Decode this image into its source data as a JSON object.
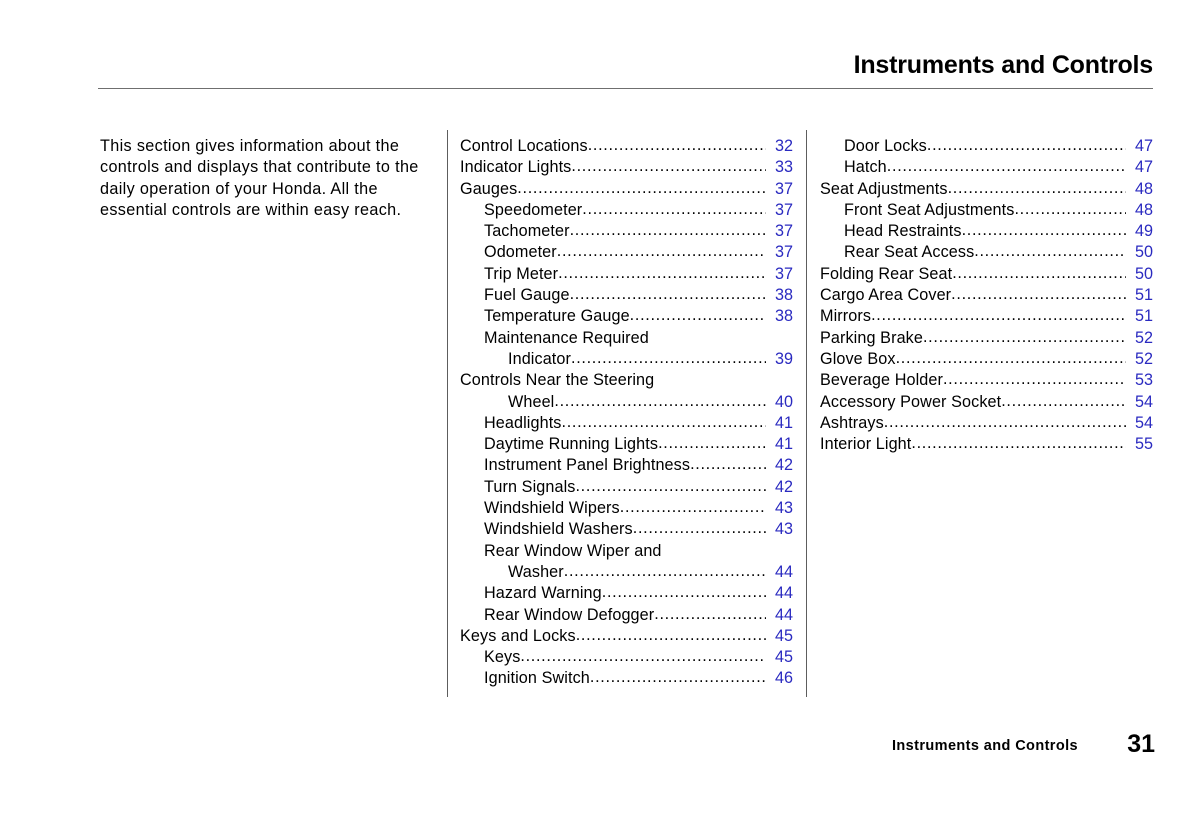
{
  "header": {
    "chapter_title": "Instruments and Controls"
  },
  "intro": {
    "paragraph": "This section gives information about the controls and displays that contribute to the daily operation of your Honda. All the essential controls are within easy reach."
  },
  "toc": {
    "middle_column": [
      {
        "label": "Control Locations",
        "page": "32",
        "level": 0
      },
      {
        "label": "Indicator Lights",
        "page": "33",
        "level": 0
      },
      {
        "label": "Gauges",
        "page": "37",
        "level": 0
      },
      {
        "label": "Speedometer",
        "page": "37",
        "level": 1
      },
      {
        "label": "Tachometer",
        "page": "37",
        "level": 1
      },
      {
        "label": "Odometer",
        "page": "37",
        "level": 1
      },
      {
        "label": "Trip Meter",
        "page": "37",
        "level": 1
      },
      {
        "label": "Fuel Gauge",
        "page": "38",
        "level": 1
      },
      {
        "label": "Temperature Gauge",
        "page": "38",
        "level": 1
      },
      {
        "label": "Maintenance Required",
        "page": "",
        "level": 1
      },
      {
        "label": "Indicator",
        "page": "39",
        "level": 2
      },
      {
        "label": "Controls Near the Steering",
        "page": "",
        "level": 0
      },
      {
        "label": "Wheel",
        "page": "40",
        "level": 2
      },
      {
        "label": "Headlights",
        "page": "41",
        "level": 1
      },
      {
        "label": "Daytime Running Lights",
        "page": "41",
        "level": 1
      },
      {
        "label": "Instrument Panel Brightness",
        "page": "42",
        "level": 1
      },
      {
        "label": "Turn Signals",
        "page": "42",
        "level": 1
      },
      {
        "label": "Windshield Wipers",
        "page": "43",
        "level": 1
      },
      {
        "label": "Windshield Washers",
        "page": "43",
        "level": 1
      },
      {
        "label": "Rear Window Wiper and",
        "page": "",
        "level": 1
      },
      {
        "label": "Washer",
        "page": "44",
        "level": 2
      },
      {
        "label": "Hazard Warning",
        "page": "44",
        "level": 1
      },
      {
        "label": "Rear Window Defogger",
        "page": "44",
        "level": 1
      },
      {
        "label": "Keys and Locks",
        "page": "45",
        "level": 0
      },
      {
        "label": "Keys",
        "page": "45",
        "level": 1
      },
      {
        "label": "Ignition Switch",
        "page": "46",
        "level": 1
      }
    ],
    "right_column": [
      {
        "label": "Door Locks",
        "page": "47",
        "level": 1
      },
      {
        "label": "Hatch",
        "page": "47",
        "level": 1
      },
      {
        "label": "Seat Adjustments",
        "page": "48",
        "level": 0
      },
      {
        "label": "Front Seat Adjustments",
        "page": "48",
        "level": 1
      },
      {
        "label": "Head Restraints",
        "page": "49",
        "level": 1
      },
      {
        "label": "Rear Seat Access",
        "page": "50",
        "level": 1
      },
      {
        "label": "Folding Rear Seat",
        "page": "50",
        "level": 0
      },
      {
        "label": "Cargo Area Cover",
        "page": "51",
        "level": 0
      },
      {
        "label": "Mirrors",
        "page": "51",
        "level": 0
      },
      {
        "label": "Parking Brake",
        "page": "52",
        "level": 0
      },
      {
        "label": "Glove Box",
        "page": "52",
        "level": 0
      },
      {
        "label": "Beverage Holder",
        "page": "53",
        "level": 0
      },
      {
        "label": "Accessory Power Socket",
        "page": "54",
        "level": 0
      },
      {
        "label": "Ashtrays",
        "page": "54",
        "level": 0
      },
      {
        "label": "Interior Light",
        "page": "55",
        "level": 0
      }
    ]
  },
  "footer": {
    "chapter_label": "Instruments and Controls",
    "page_number": "31"
  },
  "colors": {
    "page_number_blue": "#2a2ac0",
    "text_black": "#000000",
    "rule_gray": "#6f6f6f"
  }
}
